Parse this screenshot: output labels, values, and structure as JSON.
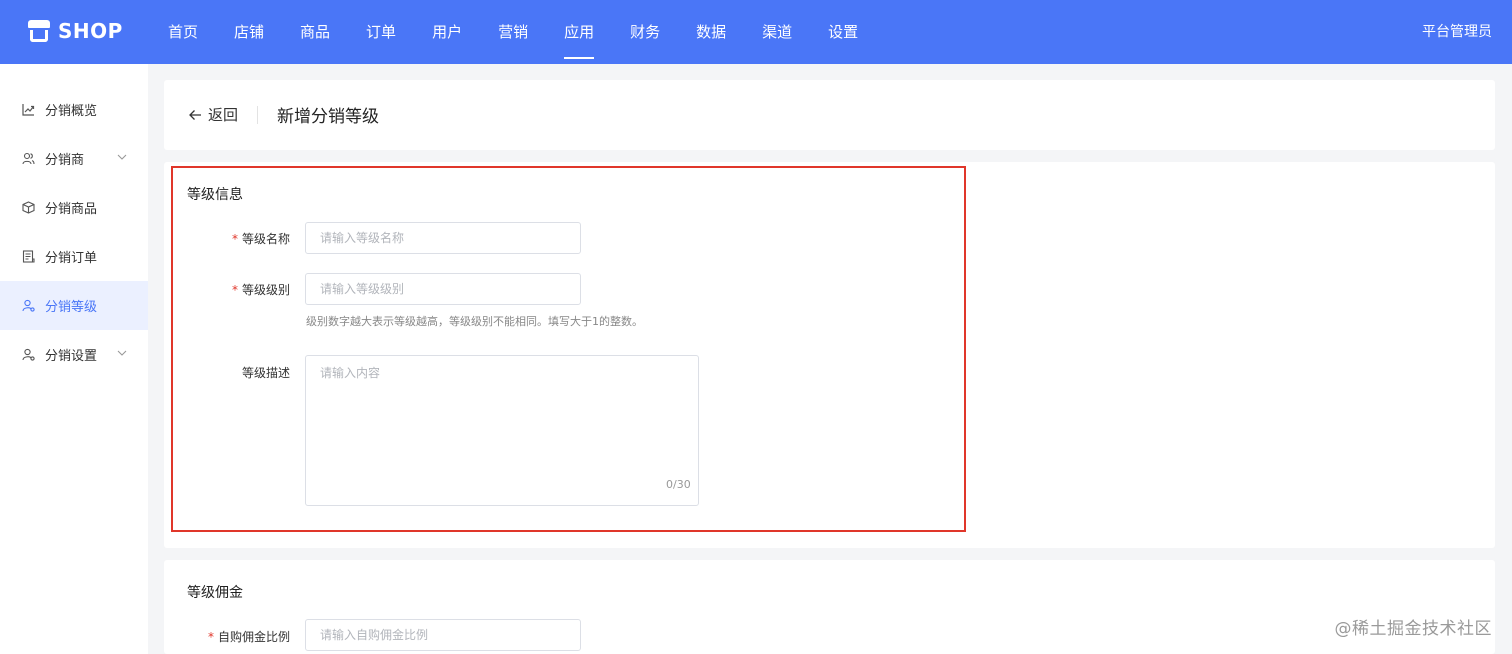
{
  "brand": {
    "name": "SHOP"
  },
  "nav": {
    "items": [
      {
        "label": "首页"
      },
      {
        "label": "店铺"
      },
      {
        "label": "商品"
      },
      {
        "label": "订单"
      },
      {
        "label": "用户"
      },
      {
        "label": "营销"
      },
      {
        "label": "应用"
      },
      {
        "label": "财务"
      },
      {
        "label": "数据"
      },
      {
        "label": "渠道"
      },
      {
        "label": "设置"
      }
    ],
    "active_index": 6,
    "user_label": "平台管理员"
  },
  "sidebar": {
    "items": [
      {
        "label": "分销概览",
        "icon": "chart-trend-icon"
      },
      {
        "label": "分销商",
        "icon": "users-icon",
        "expandable": true
      },
      {
        "label": "分销商品",
        "icon": "package-icon"
      },
      {
        "label": "分销订单",
        "icon": "receipt-icon"
      },
      {
        "label": "分销等级",
        "icon": "user-level-icon",
        "active": true
      },
      {
        "label": "分销设置",
        "icon": "user-settings-icon",
        "expandable": true
      }
    ]
  },
  "header": {
    "back_label": "返回",
    "title": "新增分销等级"
  },
  "level_info": {
    "section_title": "等级信息",
    "name": {
      "label": "等级名称",
      "placeholder": "请输入等级名称",
      "required": true,
      "value": ""
    },
    "rank": {
      "label": "等级级别",
      "placeholder": "请输入等级级别",
      "required": true,
      "value": "",
      "hint": "级别数字越大表示等级越高，等级级别不能相同。填写大于1的整数。"
    },
    "desc": {
      "label": "等级描述",
      "placeholder": "请输入内容",
      "value": "",
      "counter": "0/30"
    }
  },
  "commission": {
    "section_title": "等级佣金",
    "self_ratio": {
      "label": "自购佣金比例",
      "placeholder": "请输入自购佣金比例",
      "required": true,
      "value": ""
    }
  },
  "watermark": "@稀土掘金技术社区",
  "colors": {
    "primary": "#4a76f7",
    "highlight_border": "#e0362a",
    "required": "#e0362a"
  }
}
